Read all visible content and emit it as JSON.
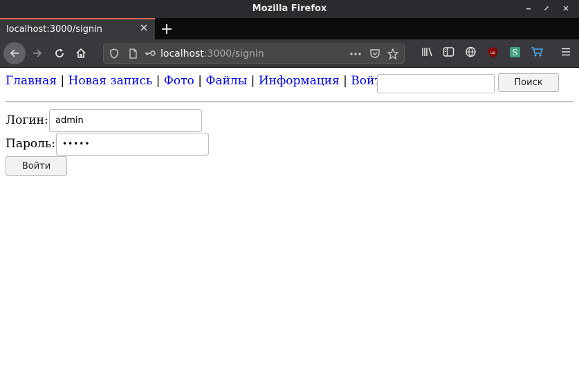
{
  "window": {
    "title": "Mozilla Firefox"
  },
  "tab": {
    "title": "localhost:3000/signin"
  },
  "urlbar": {
    "host": "localhost",
    "path": ":3000/signin"
  },
  "icons": {
    "back": "back-arrow-icon",
    "forward": "forward-arrow-icon",
    "reload": "reload-icon",
    "home": "home-icon",
    "shield": "tracking-shield-icon",
    "page": "page-info-icon",
    "key": "key-icon",
    "more": "more-actions-icon",
    "pocket": "pocket-icon",
    "bookmark": "bookmark-star-icon",
    "library": "library-icon",
    "sidebar": "sidebar-icon",
    "globe": "globe-icon",
    "ublock": "ublock-icon",
    "stylus": "stylus-icon",
    "cart": "cart-icon",
    "menu": "hamburger-menu-icon"
  },
  "nav": {
    "items": [
      "Главная",
      "Новая запись",
      "Фото",
      "Файлы",
      "Информация",
      "Войти"
    ],
    "separator": "|"
  },
  "search": {
    "value": "",
    "button_label": "Поиск"
  },
  "form": {
    "login_label": "Логин:",
    "login_value": "admin",
    "password_label": "Пароль:",
    "password_value": "•••••",
    "submit_label": "Войти"
  },
  "colors": {
    "link": "#0000ee",
    "titlebar": "#2b2a2f",
    "toolbar": "#38383d",
    "tab_accent": "#e0704b"
  }
}
